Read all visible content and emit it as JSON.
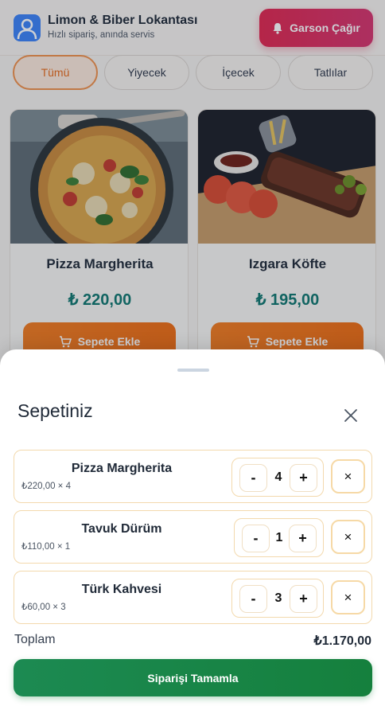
{
  "header": {
    "title": "Limon & Biber Lokantası",
    "subtitle": "Hızlı sipariş, anında servis",
    "waiter_button": "Garson Çağır",
    "logo_icon": "user-icon",
    "bell_icon": "bell-icon"
  },
  "categories": [
    "Tümü",
    "Yiyecek",
    "İçecek",
    "Tatlılar"
  ],
  "active_category": "Tümü",
  "menu": [
    {
      "name": "Pizza Margherita",
      "price": "₺ 220,00",
      "button": "Sepete Ekle"
    },
    {
      "name": "Izgara Köfte",
      "price": "₺ 195,00",
      "button": "Sepete Ekle"
    }
  ],
  "cart": {
    "title": "Sepetiniz",
    "items": [
      {
        "name": "Pizza Margherita",
        "unit": "₺220,00 × 4",
        "qty": "4",
        "minus": "-",
        "plus": "+",
        "remove": "×"
      },
      {
        "name": "Tavuk Dürüm",
        "unit": "₺110,00 × 1",
        "qty": "1",
        "minus": "-",
        "plus": "+",
        "remove": "×"
      },
      {
        "name": "Türk Kahvesi",
        "unit": "₺60,00 × 3",
        "qty": "3",
        "minus": "-",
        "plus": "+",
        "remove": "×"
      }
    ],
    "total_label": "Toplam",
    "total_value": "₺1.170,00",
    "checkout_button": "Siparişi Tamamla"
  },
  "colors": {
    "accent_orange": "#ee6c12",
    "waiter_red": "#e0264e",
    "price_teal": "#0f766e",
    "checkout_green": "#15803d",
    "item_border": "#f3d9ad"
  }
}
